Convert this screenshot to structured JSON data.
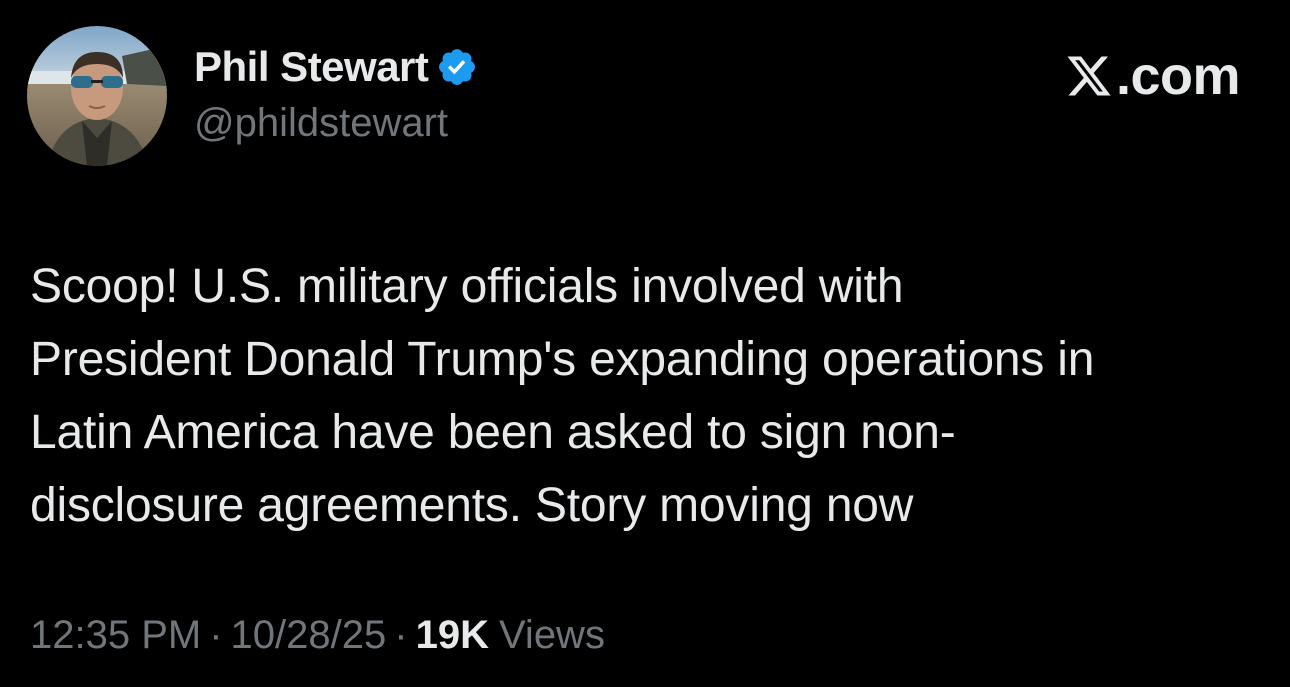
{
  "author": {
    "display_name": "Phil Stewart",
    "handle": "@phildstewart",
    "verified": true,
    "verified_color": "#1d9bf0"
  },
  "brand": {
    "icon": "x-logo-icon",
    "label": ".com"
  },
  "tweet": {
    "lines": [
      "Scoop! U.S. military officials involved with",
      "President Donald Trump's expanding operations in",
      "Latin America have been asked to sign non-",
      "disclosure agreements. Story moving now"
    ]
  },
  "meta": {
    "time": "12:35 PM",
    "separator": "·",
    "date": "10/28/25",
    "views_count": "19K",
    "views_label": "Views"
  },
  "colors": {
    "background": "#000000",
    "primary_text": "#e7e9ea",
    "secondary_text": "#71767b"
  }
}
